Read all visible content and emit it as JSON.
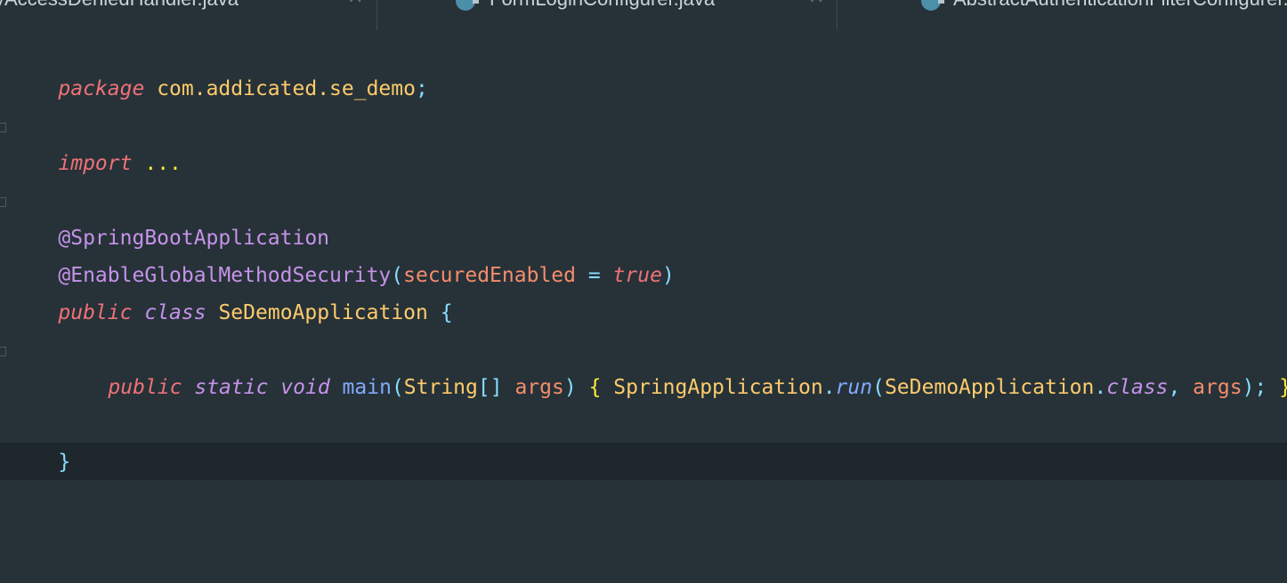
{
  "tabs": [
    {
      "label": "yAccessDeniedHandler.java",
      "close": "✕"
    },
    {
      "label": "FormLoginConfigurer.java",
      "close": "✕",
      "icon": "java-class-icon"
    },
    {
      "label": "AbstractAuthenticationFilterConfigurer.java",
      "icon": "java-class-icon"
    }
  ],
  "code": {
    "line1": {
      "kw": "package",
      "pkg": "com.addicated.se_demo",
      "semi": ";"
    },
    "line3": {
      "kw": "import",
      "dots": "..."
    },
    "line5": {
      "ann": "@SpringBootApplication"
    },
    "line6": {
      "ann": "@EnableGlobalMethodSecurity",
      "lp": "(",
      "param": "securedEnabled",
      "eq": " = ",
      "val": "true",
      "rp": ")"
    },
    "line7": {
      "kw1": "public",
      "kw2": "class",
      "name": "SeDemoApplication",
      "brace": "{"
    },
    "line9": {
      "kw1": "public",
      "kw2": "static",
      "kw3": "void",
      "fn": "main",
      "lp": "(",
      "type": "String",
      "arr": "[]",
      "arg": "args",
      "rp": ")",
      "lb": "{",
      "cls": "SpringApplication",
      "dot": ".",
      "run": "run",
      "lp2": "(",
      "cls2": "SeDemoApplication",
      "dot2": ".",
      "classkw": "class",
      "comma": ", ",
      "arg2": "args",
      "rp2": ")",
      "semi": ";",
      "rb": "}"
    },
    "line11": {
      "brace": "}"
    }
  },
  "colors": {
    "background": "#263238",
    "current_line": "#1e272c",
    "keyword": "#f07178",
    "type_keyword": "#c792ea",
    "class_name": "#ffcb6b",
    "function": "#82aaff",
    "parameter": "#f78c6c",
    "punctuation": "#89ddff"
  }
}
